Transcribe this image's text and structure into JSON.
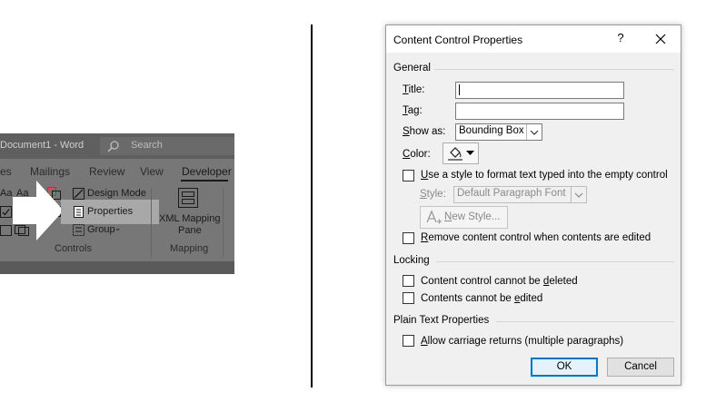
{
  "ribbon": {
    "window_title": "Document1 - Word",
    "search_placeholder": "Search",
    "tabs": [
      "es",
      "Mailings",
      "Review",
      "View",
      "Developer"
    ],
    "controls_group_label": "Controls",
    "mapping_group_label": "Mapping",
    "design_mode_label": "Design Mode",
    "properties_label": "Properties",
    "group_label": "Group",
    "xml_mapping_line1": "XML Mapping",
    "xml_mapping_line2": "Pane",
    "aa1": "Aa",
    "aa2": "Aa"
  },
  "dialog": {
    "title": "Content Control Properties",
    "help_glyph": "?",
    "general": {
      "heading": "General",
      "title_label_key": "T",
      "title_label_rest": "itle:",
      "title_value": "",
      "tag_label_key": "T",
      "tag_label_rest": "ag:",
      "tag_value": "",
      "show_as_label_key": "S",
      "show_as_label_rest": "how as:",
      "show_as_value": "Bounding Box",
      "color_label_key": "C",
      "color_label_rest": "olor:",
      "use_style_key": "U",
      "use_style_rest": "se a style to format text typed into the empty control",
      "style_label_key": "S",
      "style_label_rest": "tyle:",
      "style_value": "Default Paragraph Font",
      "new_style_key": "N",
      "new_style_rest": "ew Style...",
      "remove_key": "R",
      "remove_rest": "emove content control when contents are edited"
    },
    "locking": {
      "heading": "Locking",
      "cannot_delete_pre": "Content control cannot be ",
      "cannot_delete_key": "d",
      "cannot_delete_post": "eleted",
      "cannot_edit_pre": "Contents cannot be ",
      "cannot_edit_key": "e",
      "cannot_edit_post": "dited"
    },
    "plain_text": {
      "heading": "Plain Text Properties",
      "allow_key": "A",
      "allow_rest": "llow carriage returns (multiple paragraphs)"
    },
    "ok_label": "OK",
    "cancel_label": "Cancel"
  },
  "colors": {
    "accent": "#0078d7",
    "ribbon_bg": "#777777",
    "dialog_bg": "#f0f0f0"
  }
}
